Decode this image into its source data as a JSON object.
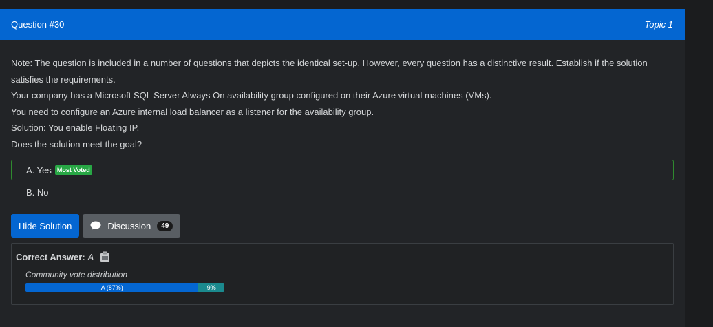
{
  "header": {
    "title": "Question #30",
    "topic": "Topic 1"
  },
  "question": {
    "paragraphs": [
      "Note: The question is included in a number of questions that depicts the identical set-up. However, every question has a distinctive result. Establish if the solution satisfies the requirements.",
      "Your company has a Microsoft SQL Server Always On availability group configured on their Azure virtual machines (VMs).",
      "You need to configure an Azure internal load balancer as a listener for the availability group.",
      "Solution: You enable Floating IP.",
      "Does the solution meet the goal?"
    ]
  },
  "choices": [
    {
      "label": "A. Yes",
      "badge": "Most Voted"
    },
    {
      "label": "B. No"
    }
  ],
  "buttons": {
    "hide_solution": "Hide Solution",
    "discussion": "Discussion",
    "discussion_count": "49"
  },
  "answer": {
    "label": "Correct Answer:",
    "value": "A",
    "vote_title": "Community vote distribution",
    "votes": [
      {
        "label": "A (87%)",
        "percent": 87,
        "color": "#0466d1"
      },
      {
        "label": "9%",
        "percent": 13,
        "color": "#1b8a8e"
      }
    ]
  },
  "colors": {
    "accent": "#0466d1",
    "success": "#28a745",
    "secondary": "#595e63"
  },
  "icons": {
    "discussion": "speech-bubble-icon",
    "answer": "clipboard-icon"
  }
}
